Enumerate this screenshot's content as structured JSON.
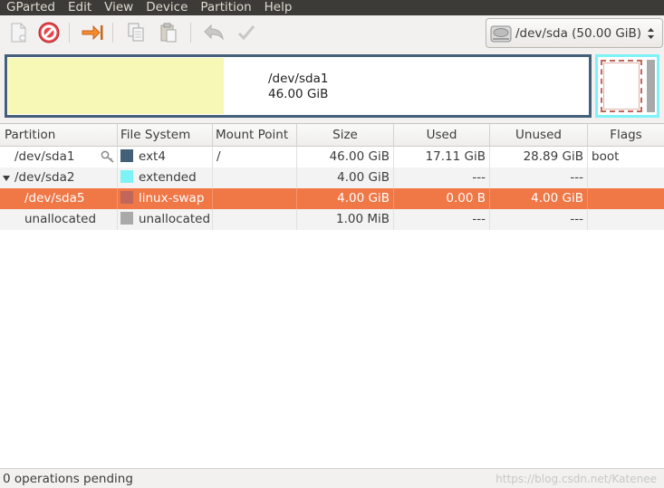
{
  "menubar": {
    "items": [
      "GParted",
      "Edit",
      "View",
      "Device",
      "Partition",
      "Help"
    ]
  },
  "toolbar": {
    "buttons": [
      "new-icon",
      "delete-icon",
      "resize-move-icon",
      "copy-icon",
      "paste-icon",
      "undo-icon",
      "apply-icon"
    ],
    "device_label": "/dev/sda  (50.00 GiB)"
  },
  "diskmap": {
    "main_name": "/dev/sda1",
    "main_size": "46.00 GiB",
    "colors": {
      "border": "#446079",
      "used": "#f7f7b6",
      "extended": "#7ef3f7",
      "swap": "#c1665a",
      "unallocated": "#a9a9a9"
    }
  },
  "table": {
    "headers": [
      "Partition",
      "File System",
      "Mount Point",
      "Size",
      "Used",
      "Unused",
      "Flags"
    ],
    "rows": [
      {
        "partition": "/dev/sda1",
        "fs": "ext4",
        "fs_color": "#446079",
        "mount": "/",
        "size": "46.00 GiB",
        "used": "17.11 GiB",
        "unused": "28.89 GiB",
        "flags": "boot",
        "has_key": true
      },
      {
        "partition": "/dev/sda2",
        "fs": "extended",
        "fs_color": "#7ef3f7",
        "mount": "",
        "size": "4.00 GiB",
        "used": "---",
        "unused": "---",
        "flags": "",
        "expander": true
      },
      {
        "partition": "/dev/sda5",
        "fs": "linux-swap",
        "fs_color": "#c1665a",
        "mount": "",
        "size": "4.00 GiB",
        "used": "0.00 B",
        "unused": "4.00 GiB",
        "flags": "",
        "selected": true
      },
      {
        "partition": "unallocated",
        "fs": "unallocated",
        "fs_color": "#a9a9a9",
        "mount": "",
        "size": "1.00 MiB",
        "used": "---",
        "unused": "---",
        "flags": ""
      }
    ]
  },
  "status": {
    "text": "0 operations pending",
    "watermark": "https://blog.csdn.net/Katenee"
  }
}
